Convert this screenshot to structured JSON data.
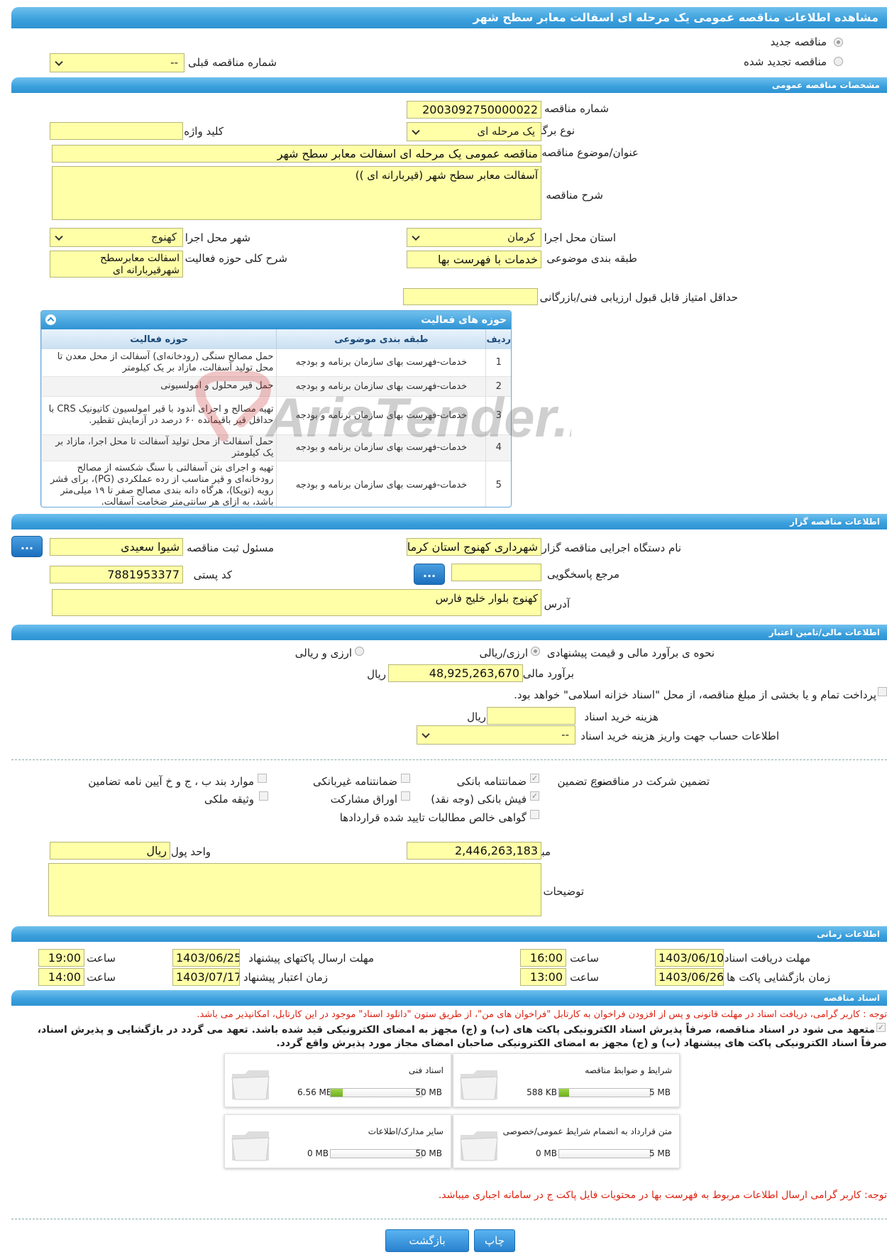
{
  "page_title": "مشاهده اطلاعات مناقصه عمومی یک مرحله ای اسفالت معابر سطح شهر",
  "radios": {
    "new": "مناقصه جدید",
    "renewed": "مناقصه تجدید شده"
  },
  "prev_tender": {
    "label": "شماره مناقصه قبلی",
    "value": "--"
  },
  "sections": {
    "general": "مشخصات مناقصه عمومی",
    "organizer": "اطلاعات مناقصه گزار",
    "finance": "اطلاعات مالی/تامین اعتبار",
    "timing": "اطلاعات زمانی",
    "docs": "اسناد مناقصه"
  },
  "general": {
    "number_label": "شماره مناقصه",
    "number": "2003092750000022",
    "type_label": "نوع برگزاری",
    "type": "یک مرحله ای",
    "keyword_label": "کلید واژه",
    "keyword": "",
    "title_label": "عنوان/موضوع مناقصه",
    "title": "مناقصه عمومی یک مرحله ای اسفالت معابر سطح شهر",
    "desc_label": "شرح مناقصه",
    "desc": "آسفالت معابر سطح شهر (قیربارانه ای ))",
    "province_label": "استان محل اجرا",
    "province": "کرمان",
    "city_label": "شهر محل اجرا",
    "city": "کهنوج",
    "category_label": "طبقه بندی موضوعی",
    "category": "خدمات با فهرست بها",
    "scope_label": "شرح کلی حوزه فعالیت",
    "scope": "اسفالت معابرسطح شهرقیربارانه ای",
    "minscore_label": "حداقل امتیاز قابل قبول ارزیابی فنی/بازرگانی",
    "minscore": ""
  },
  "activities": {
    "title": "حوزه های فعالیت",
    "headers": [
      "ردیف",
      "طبقه بندی موضوعی",
      "حوزه فعالیت"
    ],
    "rows": [
      {
        "n": "1",
        "cat": "خدمات-فهرست بهای سازمان برنامه و بودجه",
        "act": "حمل مصالح سنگی (رودخانه‌ای) آسفالت از محل معدن تا محل تولید آسفالت، مازاد بر یک کیلومتر"
      },
      {
        "n": "2",
        "cat": "خدمات-فهرست بهای سازمان برنامه و بودجه",
        "act": "حمل قیر محلول و امولسیونی"
      },
      {
        "n": "3",
        "cat": "خدمات-فهرست بهای سازمان برنامه و بودجه",
        "act": "تهیه مصالح و اجرای اندود با قیر امولسیون کاتیونیک CRS با حداقل قیر باقیمانده ۶۰ درصد در آزمایش تقطیر."
      },
      {
        "n": "4",
        "cat": "خدمات-فهرست بهای سازمان برنامه و بودجه",
        "act": "حمل آسفالت از محل تولید آسفالت تا محل اجرا، مازاد بر یک کیلومتر"
      },
      {
        "n": "5",
        "cat": "خدمات-فهرست بهای سازمان برنامه و بودجه",
        "act": "تهیه و اجرای بتن آسفالتی با سنگ شکسته از مصالح رودخانه‌ای و قیر مناسب از رده عملکردی (PG)، برای قشر رویه (توپکا)، هرگاه دانه بندی مصالح صفر تا ۱۹ میلی‌متر باشد، به ازای هر سانتی‌متر ضخامت آسفالت."
      }
    ]
  },
  "organizer": {
    "name_label": "نام دستگاه اجرایی مناقصه گزار",
    "name": "شهرداری کهنوج استان کرمان",
    "resp_label": "مسئول ثبت مناقصه",
    "resp": "شیوا سعیدی",
    "ref_label": "مرجع پاسخگویی",
    "ref": "",
    "postal_label": "کد پستی",
    "postal": "7881953377",
    "addr_label": "آدرس",
    "addr": "کهنوج بلوار خلیج فارس",
    "dots": "..."
  },
  "finance": {
    "method_label": "نحوه ی برآورد مالی و قیمت پیشنهادی",
    "opt1": "ارزی/ریالی",
    "opt2": "ارزی و ریالی",
    "estimate_label": "برآورد مالی",
    "estimate": "48,925,263,670",
    "rial": "ریال",
    "treasury": "پرداخت تمام و یا بخشی از مبلغ مناقصه، از محل \"اسناد خزانه اسلامی\" خواهد بود.",
    "fee_label": "هزینه خرید اسناد",
    "fee_unit": "ریال",
    "account_label": "اطلاعات حساب جهت واریز هزینه خرید اسناد",
    "account": "--"
  },
  "guarantee": {
    "label": "تضمین شرکت در مناقصه:",
    "type_label": "نوع تضمین",
    "items": [
      "ضمانتنامه بانکی",
      "ضمانتنامه غیربانکی",
      "موارد بند ب ، ج و خ آیین نامه تضامین",
      "فیش بانکی (وجه نقد)",
      "اوراق مشارکت",
      "وثیقه ملکی",
      "گواهی خالص مطالبات تایید شده قراردادها"
    ],
    "amount_label": "مبلغ تضمین",
    "amount": "2,446,263,183",
    "currency_label": "واحد پول",
    "currency": "ریال",
    "notes_label": "توضیحات",
    "notes": ""
  },
  "timing": {
    "receive_label": "مهلت دریافت اسناد",
    "receive_date": "1403/06/10",
    "receive_time": "16:00",
    "send_label": "مهلت ارسال پاکتهای پیشنهاد",
    "send_date": "1403/06/25",
    "send_time": "19:00",
    "open_label": "زمان بازگشایی پاکت ها",
    "open_date": "1403/06/26",
    "open_time": "13:00",
    "valid_label": "زمان اعتبار پیشنهاد",
    "valid_date": "1403/07/17",
    "valid_time": "14:00",
    "time_label": "ساعت"
  },
  "docs": {
    "note1": "توجه : کاربر گرامی، دریافت اسناد در مهلت قانونی و پس از افزودن فراخوان به کارتابل \"فراخوان های من\"، از طریق ستون \"دانلود اسناد\" موجود در این کارتابل، امکانپذیر می باشد.",
    "commit1": "متعهد می شود در اسناد مناقصه، صرفاً پذیرش اسناد الکترونیکی پاکت های (ب) و (ج) مجهز به امضای الکترونیکی قید شده باشد. تعهد می گردد در بازگشایی و پذیرش اسناد،",
    "commit2": "صرفاً اسناد الکترونیکی پاکت های پیشنهاد (ب) و (ج) مجهز به امضای الکترونیکی صاحبان امضای مجاز مورد پذیرش واقع گردد.",
    "tiles": [
      {
        "title": "شرایط و ضوابط مناقصه",
        "size": "588 KB",
        "max": "5 MB",
        "fill": 0.11
      },
      {
        "title": "اسناد فنی",
        "size": "6.56 MB",
        "max": "50 MB",
        "fill": 0.13
      },
      {
        "title": "متن قرارداد به انضمام شرایط عمومی/خصوصی",
        "size": "0 MB",
        "max": "5 MB",
        "fill": 0
      },
      {
        "title": "سایر مدارک/اطلاعات",
        "size": "0 MB",
        "max": "50 MB",
        "fill": 0
      }
    ],
    "note2": "توجه: کاربر گرامی ارسال اطلاعات مربوط به فهرست بها در محتویات فایل پاکت ج در سامانه اجباری میباشد."
  },
  "buttons": {
    "print": "چاپ",
    "back": "بازگشت"
  },
  "watermark": "AriaTender.neT",
  "colors": {
    "accent": "#2f93d3",
    "field": "#ffffa8",
    "notice": "#d21111"
  }
}
